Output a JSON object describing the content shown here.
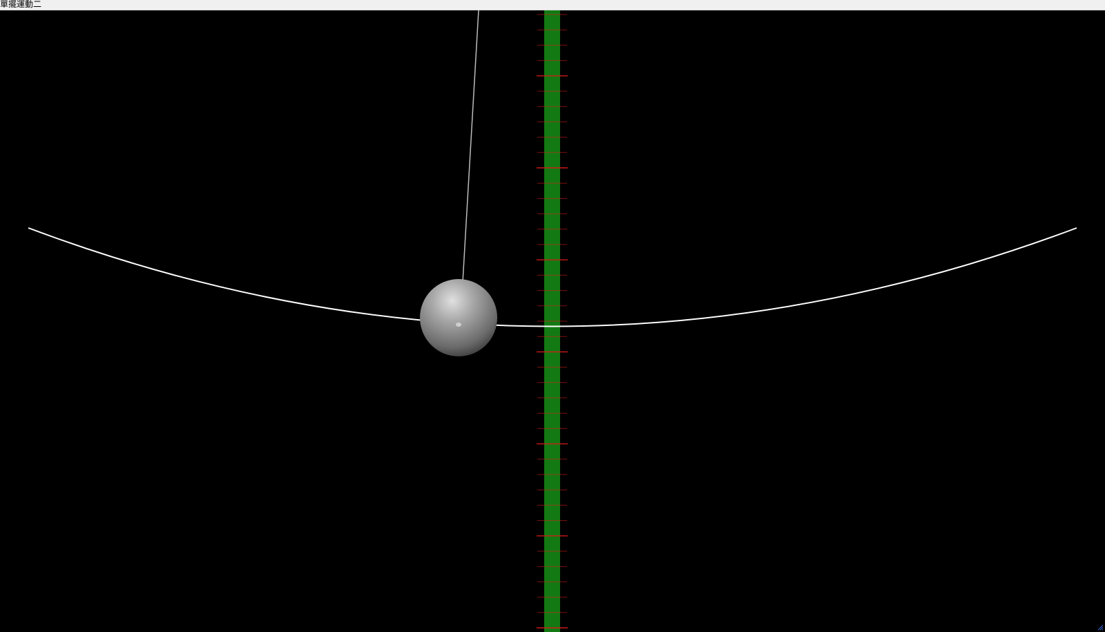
{
  "window": {
    "title": "單擺運動二"
  },
  "scene": {
    "background_color": "#000000",
    "ruler": {
      "color": "#137a13",
      "tick_color": "#d81b1b",
      "tick_count": 41
    },
    "trajectory": {
      "color": "#ffffff",
      "shape": "arc"
    },
    "pendulum": {
      "string_color": "#bdbdbd",
      "bob_color": "#8a8a8a",
      "bob_highlight_color": "#f0f0f0"
    }
  },
  "icons": {
    "resize_grip": "resize-grip-icon"
  }
}
